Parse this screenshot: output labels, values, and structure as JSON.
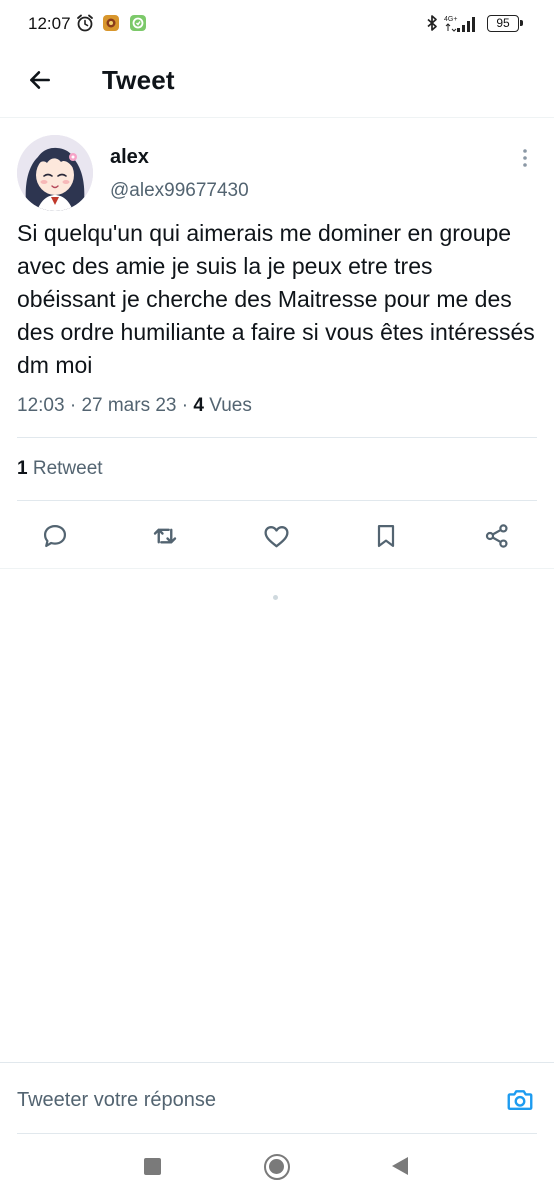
{
  "status_bar": {
    "time": "12:07",
    "network": "4G+",
    "battery": "95",
    "icons": [
      "alarm-icon",
      "app-icon",
      "app-icon",
      "bluetooth-icon",
      "signal-icon"
    ]
  },
  "header": {
    "back_icon": "arrow-left-icon",
    "title": "Tweet"
  },
  "tweet": {
    "author": {
      "name": "alex",
      "handle": "@alex99677430"
    },
    "text": "Si quelqu'un qui aimerais me dominer en groupe avec des amie je suis la je peux etre tres obéissant je cherche des Maitresse pour me des des ordre humiliante a faire si vous êtes intéressés dm moi",
    "time": "12:03",
    "date": "27 mars 23",
    "views_count": "4",
    "views_label": "Vues",
    "retweets_count": "1",
    "retweets_label": "Retweet"
  },
  "actions": [
    "reply-icon",
    "retweet-icon",
    "like-icon",
    "bookmark-icon",
    "share-icon"
  ],
  "reply": {
    "placeholder": "Tweeter votre réponse"
  },
  "colors": {
    "accent": "#1d9bf0",
    "text": "#0f1419",
    "secondary": "#536471",
    "divider": "#e1e8ed"
  }
}
